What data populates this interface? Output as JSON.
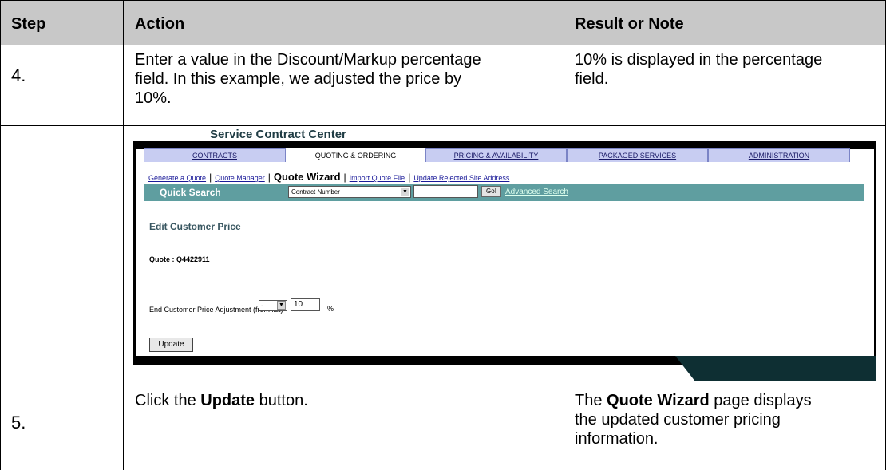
{
  "table": {
    "headers": {
      "step": "Step",
      "action": "Action",
      "result": "Result or Note"
    },
    "rows": [
      {
        "step": "4.",
        "action_lines": [
          "Enter a value in the Discount/Markup percentage",
          "field. In this example, we adjusted the price by",
          "10%."
        ],
        "result_lines": [
          "10% is displayed in the percentage",
          "field."
        ]
      },
      {
        "step": "5.",
        "action_parts": [
          "Click the ",
          "Update",
          " button."
        ],
        "result_parts": [
          "The ",
          "Quote Wizard",
          " page displays"
        ],
        "result_lines_extra": [
          "the updated customer pricing",
          "information."
        ]
      }
    ]
  },
  "app": {
    "title": "Service Contract Center",
    "tabs": [
      "CONTRACTS",
      "QUOTING & ORDERING",
      "PRICING & AVAILABILITY",
      "PACKAGED SERVICES",
      "ADMINISTRATION"
    ],
    "active_tab": "QUOTING & ORDERING",
    "subnav": {
      "generate": "Generate a Quote",
      "manager": "Quote Manager",
      "wizard": "Quote Wizard",
      "import": "Import Quote File",
      "update_rejected": "Update Rejected Site Address"
    },
    "quick_search": {
      "label": "Quick Search",
      "select_value": "Contract Number",
      "input_value": "",
      "go": "Go!",
      "advanced": "Advanced Search"
    },
    "section_title": "Edit Customer Price",
    "quote": "Quote : Q4422911",
    "adjustment": {
      "label": "End Customer Price Adjustment (from list)",
      "sign": "-",
      "value": "10",
      "unit": "%"
    },
    "update_button": "Update",
    "icons": {
      "dropdown": "dropdown-arrow-icon"
    }
  }
}
